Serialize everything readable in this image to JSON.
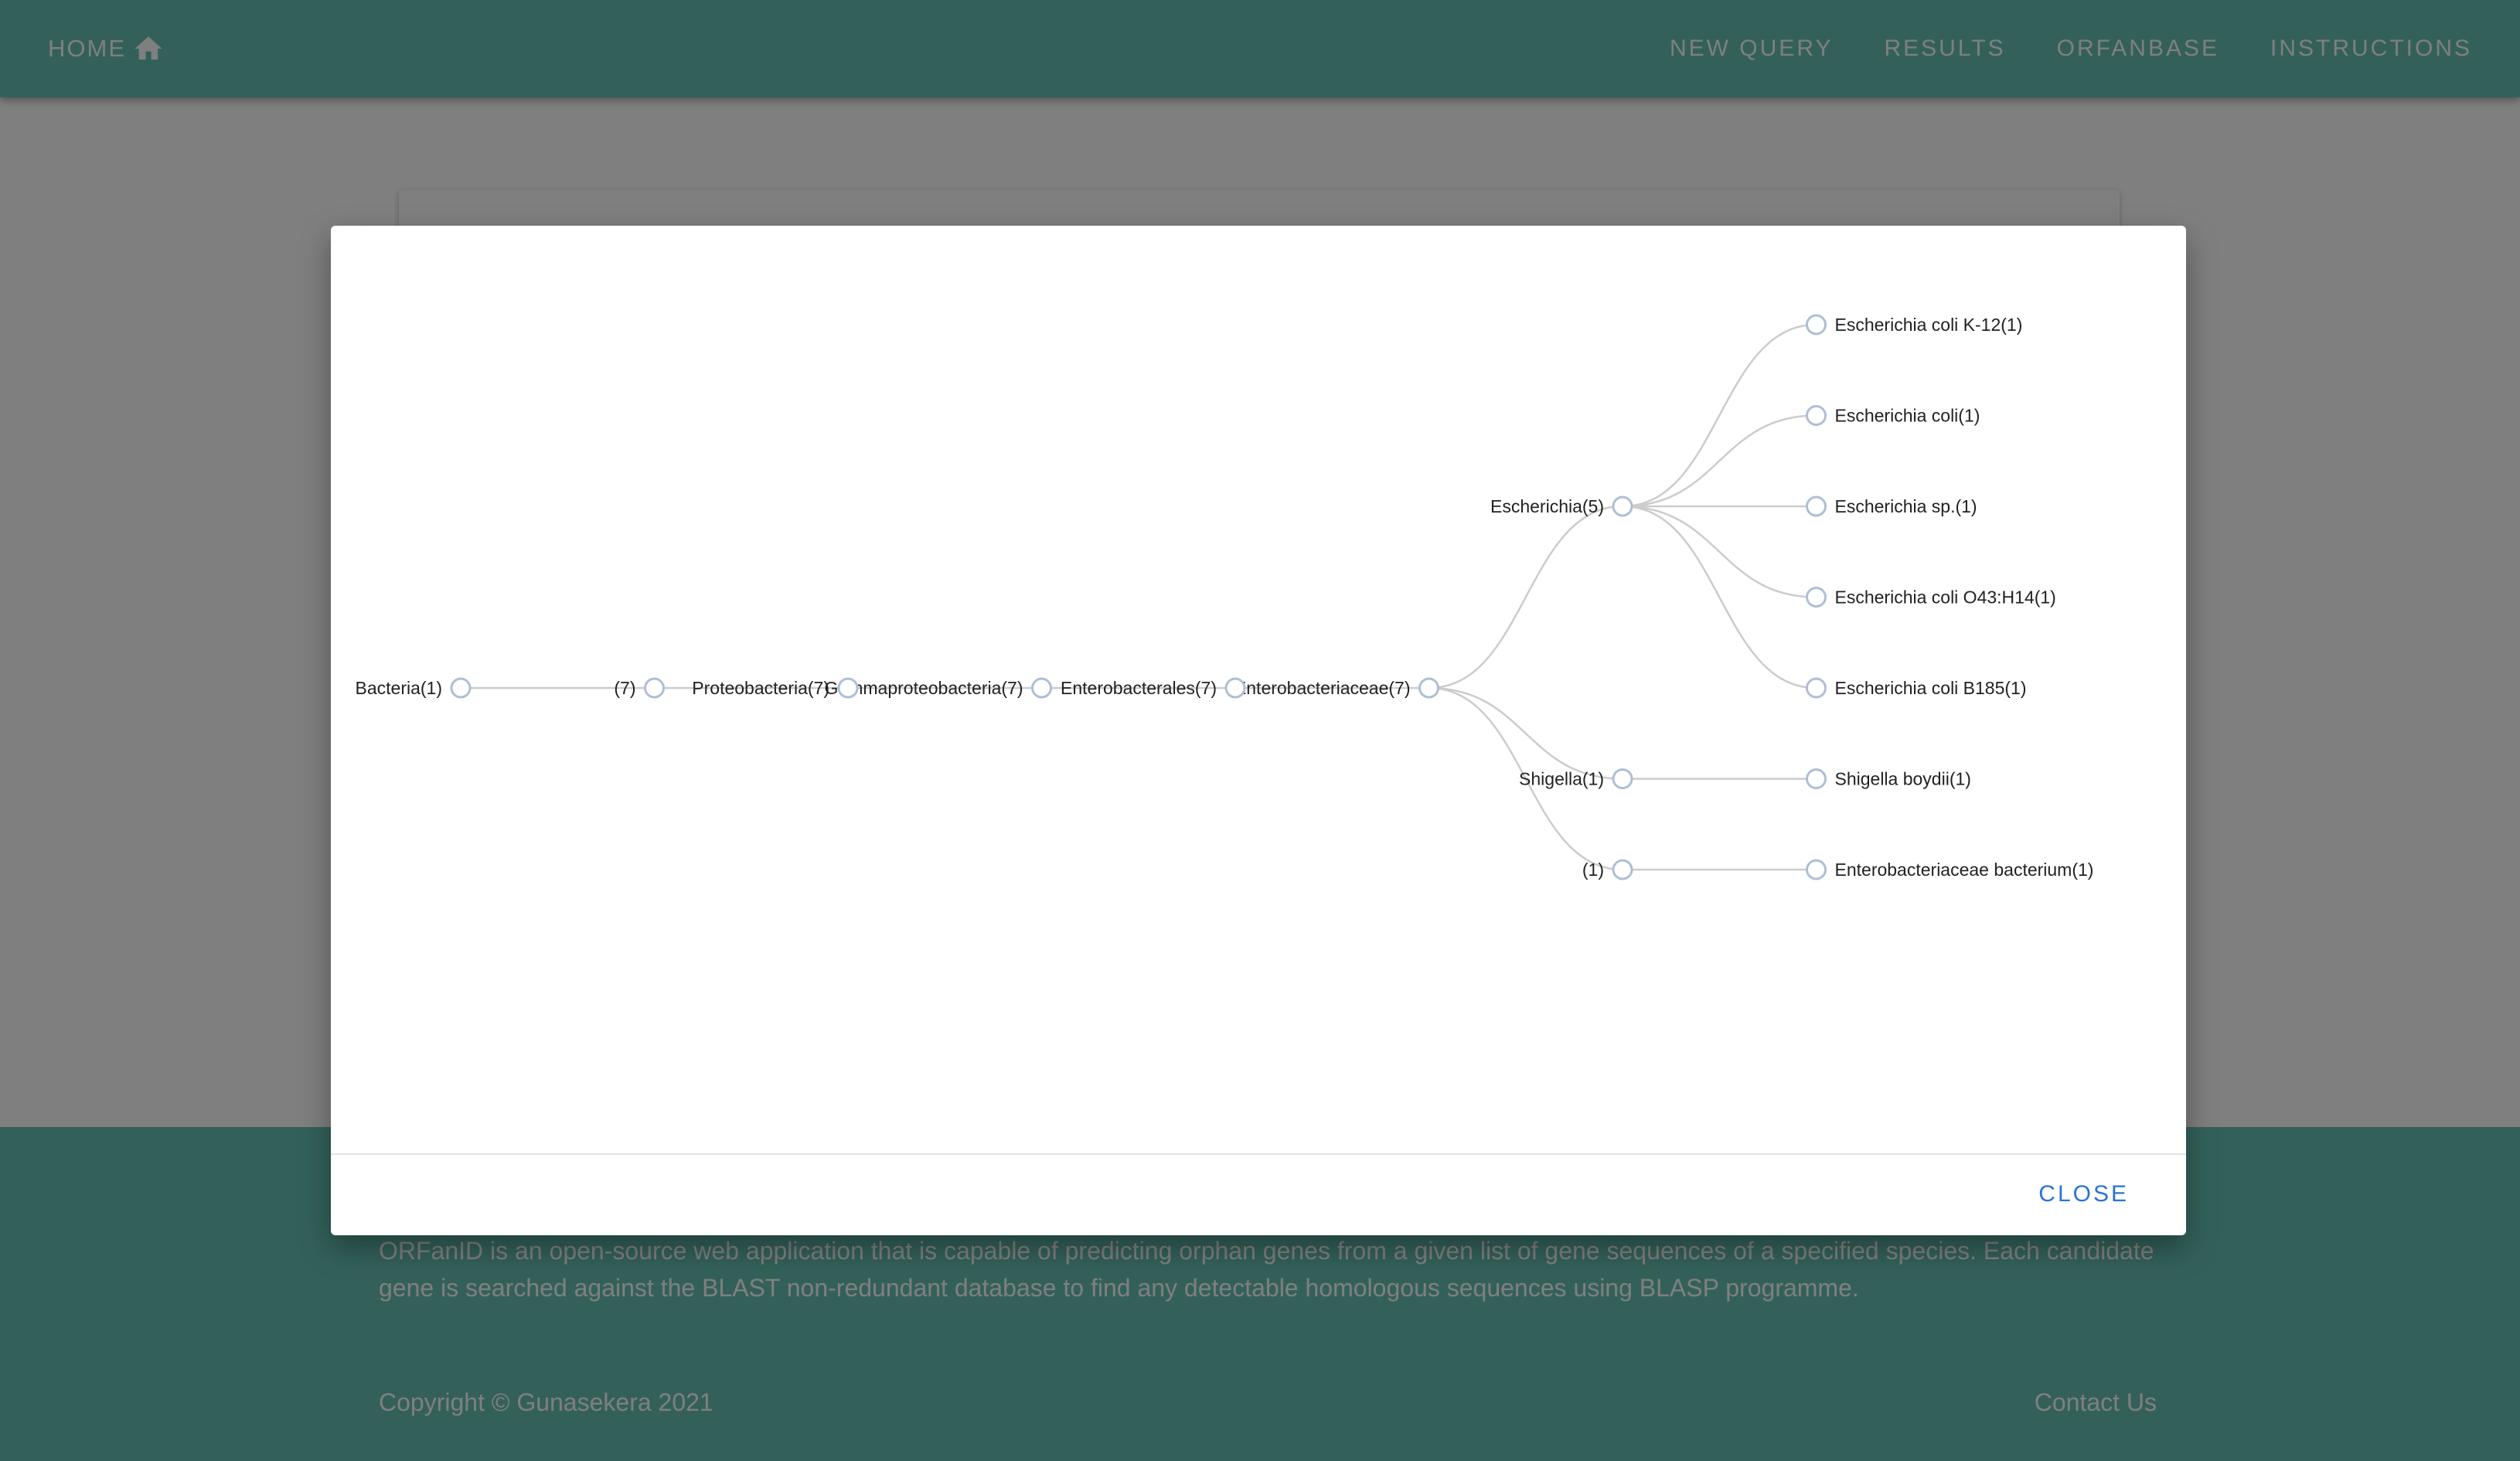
{
  "navbar": {
    "home_label": "HOME",
    "links": [
      "NEW QUERY",
      "RESULTS",
      "ORFANBASE",
      "INSTRUCTIONS"
    ]
  },
  "footer": {
    "about_text": "ORFanID is an open-source web application that is capable of predicting orphan genes from a given list of gene sequences of a specified species. Each candidate gene is searched against the BLAST non-redundant database to find any detectable homologous sequences using BLASP programme.",
    "copyright": "Copyright  © Gunasekera 2021",
    "contact_label": "Contact Us"
  },
  "modal": {
    "close_label": "CLOSE"
  },
  "colors": {
    "brand_teal": "#66c2b4",
    "close_blue": "#2a73d6",
    "node_stroke": "#aebfd4",
    "link_stroke": "#cccccc"
  },
  "taxonomy_tree": {
    "name": "Bacteria(1)",
    "children": [
      {
        "name": "(7)",
        "children": [
          {
            "name": "Proteobacteria(7)",
            "children": [
              {
                "name": "Gammaproteobacteria(7)",
                "children": [
                  {
                    "name": "Enterobacterales(7)",
                    "children": [
                      {
                        "name": "Enterobacteriaceae(7)",
                        "children": [
                          {
                            "name": "Escherichia(5)",
                            "children": [
                              {
                                "name": "Escherichia coli K-12(1)"
                              },
                              {
                                "name": "Escherichia coli(1)"
                              },
                              {
                                "name": "Escherichia sp.(1)"
                              },
                              {
                                "name": "Escherichia coli O43:H14(1)"
                              },
                              {
                                "name": "Escherichia coli B185(1)"
                              }
                            ]
                          },
                          {
                            "name": "Shigella(1)",
                            "children": [
                              {
                                "name": "Shigella boydii(1)"
                              }
                            ]
                          },
                          {
                            "name": "(1)",
                            "children": [
                              {
                                "name": "Enterobacteriaceae bacterium(1)"
                              }
                            ]
                          }
                        ]
                      }
                    ]
                  }
                ]
              }
            ]
          }
        ]
      }
    ]
  }
}
